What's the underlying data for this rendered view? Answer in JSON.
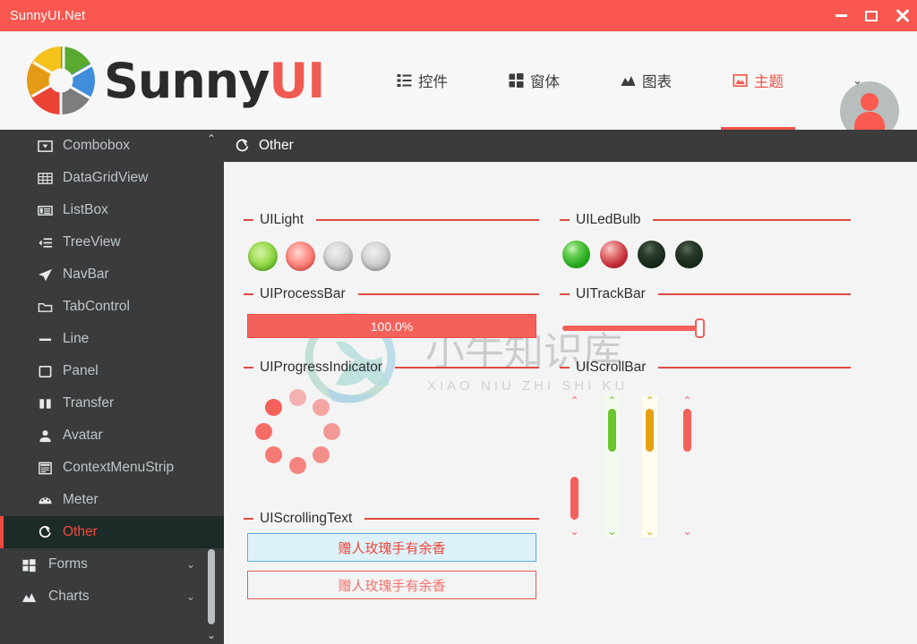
{
  "window": {
    "title": "SunnyUI.Net",
    "accent": "#f9574f",
    "controls": [
      {
        "name": "minimize",
        "glyph": "minimize-icon"
      },
      {
        "name": "maximize",
        "glyph": "maximize-icon"
      },
      {
        "name": "close",
        "glyph": "close-icon"
      }
    ]
  },
  "brand": {
    "text_primary": "Sunny",
    "text_accent": "UI"
  },
  "topnav": {
    "items": [
      {
        "label": "控件",
        "icon": "list-icon",
        "active": false
      },
      {
        "label": "窗体",
        "icon": "windows-icon",
        "active": false
      },
      {
        "label": "图表",
        "icon": "chart-icon",
        "active": false
      },
      {
        "label": "主题",
        "icon": "image-icon",
        "active": true
      }
    ],
    "chevron": "⌄"
  },
  "sidebar": {
    "items": [
      {
        "label": "Combobox",
        "icon": "combobox-icon",
        "selected": false,
        "group": false
      },
      {
        "label": "DataGridView",
        "icon": "grid-icon",
        "selected": false,
        "group": false
      },
      {
        "label": "ListBox",
        "icon": "listbox-icon",
        "selected": false,
        "group": false
      },
      {
        "label": "TreeView",
        "icon": "treeview-icon",
        "selected": false,
        "group": false
      },
      {
        "label": "NavBar",
        "icon": "paperplane-icon",
        "selected": false,
        "group": false
      },
      {
        "label": "TabControl",
        "icon": "folder-icon",
        "selected": false,
        "group": false
      },
      {
        "label": "Line",
        "icon": "line-icon",
        "selected": false,
        "group": false
      },
      {
        "label": "Panel",
        "icon": "panel-icon",
        "selected": false,
        "group": false
      },
      {
        "label": "Transfer",
        "icon": "transfer-icon",
        "selected": false,
        "group": false
      },
      {
        "label": "Avatar",
        "icon": "person-icon",
        "selected": false,
        "group": false
      },
      {
        "label": "ContextMenuStrip",
        "icon": "menustrip-icon",
        "selected": false,
        "group": false
      },
      {
        "label": "Meter",
        "icon": "meter-icon",
        "selected": false,
        "group": false
      },
      {
        "label": "Other",
        "icon": "other-icon",
        "selected": true,
        "group": false
      },
      {
        "label": "Forms",
        "icon": "windows-icon",
        "selected": false,
        "group": true,
        "chevron": "⌄"
      },
      {
        "label": "Charts",
        "icon": "chart-icon",
        "selected": false,
        "group": true,
        "chevron": "⌄"
      }
    ],
    "scroll": {
      "up": "⌃",
      "down": "⌄"
    }
  },
  "content": {
    "header": {
      "title": "Other",
      "icon": "other-icon"
    },
    "watermark": {
      "chinese": "小牛知识库",
      "pinyin": "XIAO NIU ZHI SHI KU"
    },
    "groups": {
      "uilight": "UILight",
      "uiledbulb": "UILedBulb",
      "uiprocessbar": "UIProcessBar",
      "uitrackbar": "UITrackBar",
      "uiprogressindicator": "UIProgressIndicator",
      "uiscrollbar": "UIScrollBar",
      "uiscrollingtext": "UIScrollingText"
    },
    "lights": [
      {
        "state": "on",
        "color": "green"
      },
      {
        "state": "on",
        "color": "red"
      },
      {
        "state": "off",
        "color": "grey"
      },
      {
        "state": "off",
        "color": "grey"
      }
    ],
    "ledbulbs": [
      {
        "state": "on",
        "color": "#27ab1f"
      },
      {
        "state": "on",
        "color": "#c42f3a"
      },
      {
        "state": "off",
        "color": "#15271a"
      },
      {
        "state": "off",
        "color": "#15271a"
      }
    ],
    "processbar": {
      "value": 100,
      "label": "100.0%",
      "color": "#f4605a"
    },
    "trackbar": {
      "value": 100,
      "color": "#f4605a"
    },
    "progress_indicator": {
      "dots": 8,
      "color": "#f4605a"
    },
    "scrollbars": [
      {
        "track": "transparent",
        "thumb": "#f4605a",
        "arrow": "#f4605a",
        "thumb_at": "bottom"
      },
      {
        "track": "#f2fbef",
        "thumb": "#6bc32e",
        "arrow": "#6bc32e",
        "thumb_at": "top"
      },
      {
        "track": "#fdfdef",
        "thumb": "#e8a013",
        "arrow": "#e8a013",
        "thumb_at": "top"
      },
      {
        "track": "transparent",
        "thumb": "#f4605a",
        "arrow": "#f4605a",
        "thumb_at": "top"
      }
    ],
    "scrolling_texts": [
      {
        "text": "赠人玫瑰手有余香",
        "bg": "#ddf2f8",
        "border": "#5aacea",
        "color": "#f0443c"
      },
      {
        "text": "赠人玫瑰手有余香",
        "bg": "#f4f4f4",
        "border": "#e8584f",
        "color": "#f4726c"
      }
    ]
  }
}
